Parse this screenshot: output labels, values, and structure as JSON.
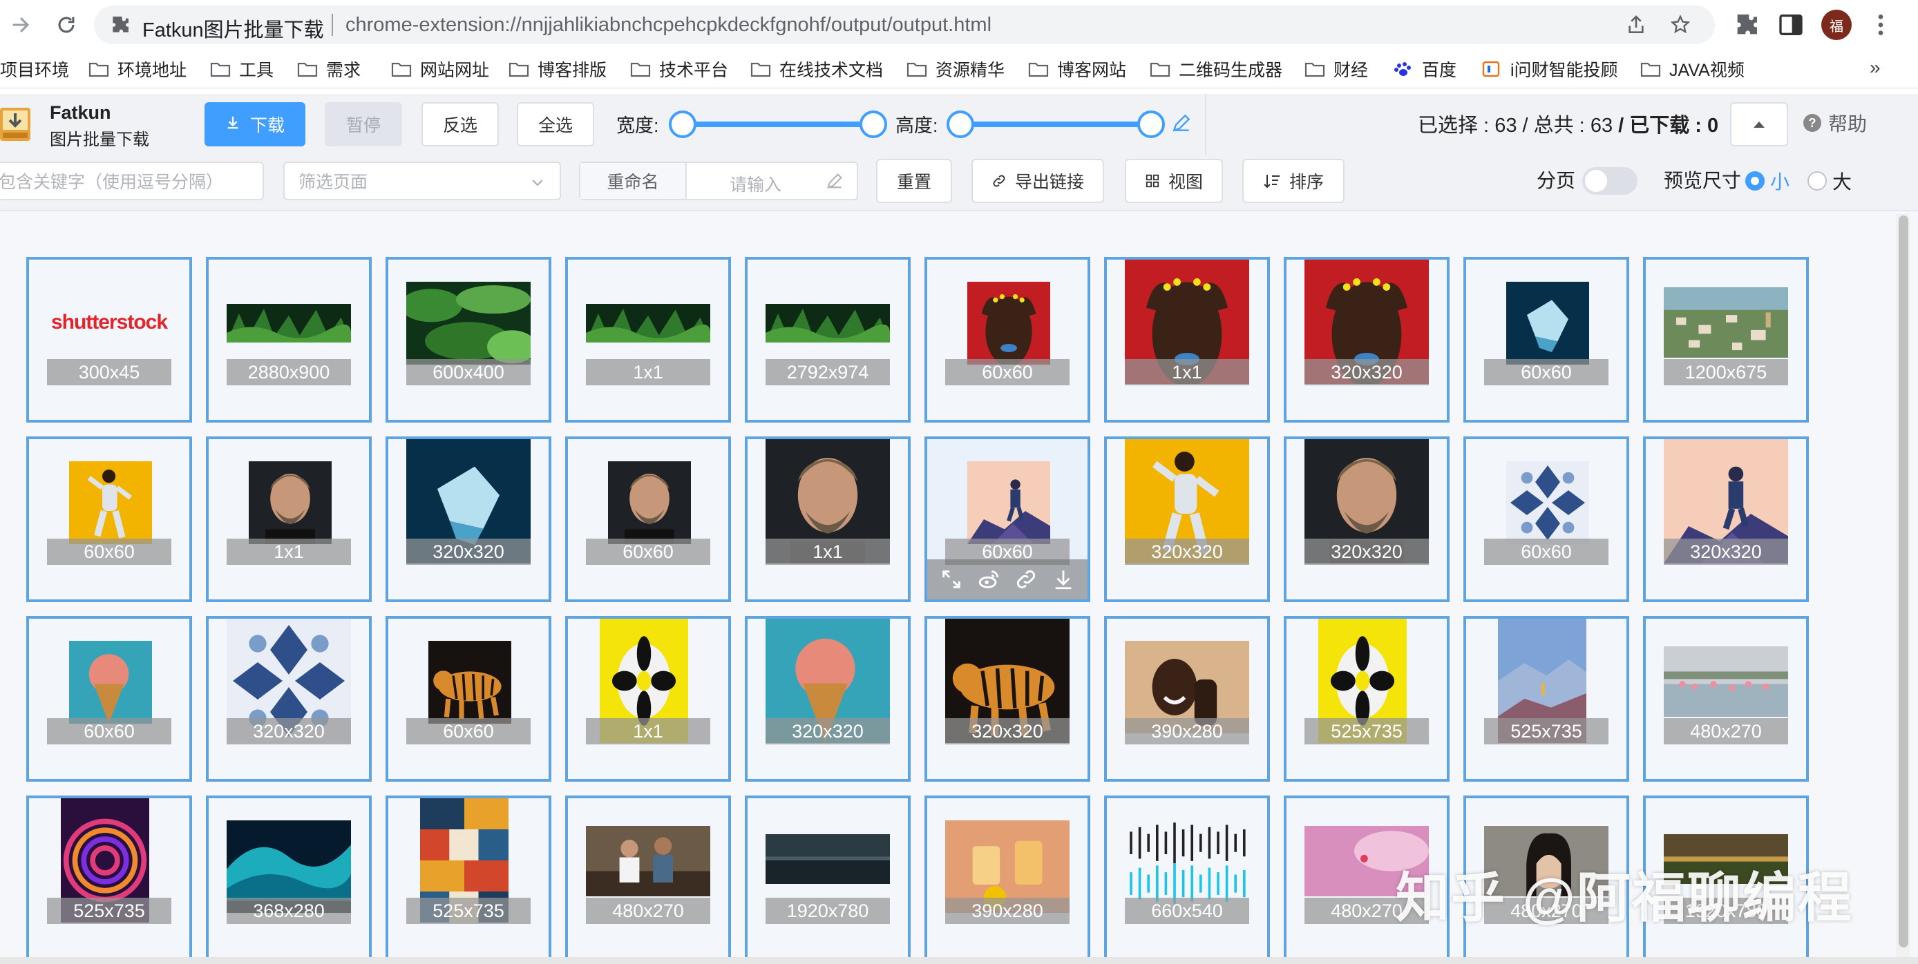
{
  "browser": {
    "tab_title": "Fatkun图片批量下载",
    "url": "chrome-extension://nnjjahlikiabnchcpehcpkdeckfgnohf/output/output.html",
    "avatar_text": "福"
  },
  "bookmarks": {
    "items": [
      {
        "label": "项目环境"
      },
      {
        "label": "环境地址"
      },
      {
        "label": "工具"
      },
      {
        "label": "需求"
      },
      {
        "label": "网站网址"
      },
      {
        "label": "博客排版"
      },
      {
        "label": "技术平台"
      },
      {
        "label": "在线技术文档"
      },
      {
        "label": "资源精华"
      },
      {
        "label": "博客网站"
      },
      {
        "label": "二维码生成器"
      },
      {
        "label": "财经"
      },
      {
        "label": "百度"
      },
      {
        "label": "i问财智能投顾"
      },
      {
        "label": "JAVA视频"
      }
    ],
    "more": "»"
  },
  "header": {
    "app_name": "Fatkun",
    "app_sub": "图片批量下载",
    "download": "下载",
    "pause": "暂停",
    "invert": "反选",
    "select_all": "全选",
    "width_label": "宽度:",
    "height_label": "高度:",
    "status_selected_label": "已选择 :",
    "status_selected": "63",
    "status_total_label": "/ 总共 :",
    "status_total": "63",
    "status_downloaded_label": "/ 已下载 :",
    "status_downloaded": "0",
    "help": "帮助"
  },
  "filters": {
    "keyword_placeholder": "包含关键字（使用逗号分隔）",
    "page_placeholder": "筛选页面",
    "rename_label": "重命名",
    "rename_placeholder": "请输入",
    "reset": "重置",
    "export": "导出链接",
    "view": "视图",
    "sort": "排序",
    "paging": "分页",
    "preview_size": "预览尺寸",
    "size_small": "小",
    "size_large": "大"
  },
  "images": [
    {
      "size": "300x45"
    },
    {
      "size": "2880x900"
    },
    {
      "size": "600x400"
    },
    {
      "size": "1x1"
    },
    {
      "size": "2792x974"
    },
    {
      "size": "60x60"
    },
    {
      "size": "1x1"
    },
    {
      "size": "320x320"
    },
    {
      "size": "60x60"
    },
    {
      "size": "1200x675"
    },
    {
      "size": "60x60"
    },
    {
      "size": "1x1"
    },
    {
      "size": "320x320"
    },
    {
      "size": "60x60"
    },
    {
      "size": "1x1"
    },
    {
      "size": "60x60"
    },
    {
      "size": "320x320"
    },
    {
      "size": "320x320"
    },
    {
      "size": "60x60"
    },
    {
      "size": "320x320"
    },
    {
      "size": "60x60"
    },
    {
      "size": "320x320"
    },
    {
      "size": "60x60"
    },
    {
      "size": "1x1"
    },
    {
      "size": "320x320"
    },
    {
      "size": "320x320"
    },
    {
      "size": "390x280"
    },
    {
      "size": "525x735"
    },
    {
      "size": "525x735"
    },
    {
      "size": "480x270"
    },
    {
      "size": "525x735"
    },
    {
      "size": "368x280"
    },
    {
      "size": "525x735"
    },
    {
      "size": "480x270"
    },
    {
      "size": "1920x780"
    },
    {
      "size": "390x280"
    },
    {
      "size": "660x540"
    },
    {
      "size": "480x270"
    },
    {
      "size": "480x270"
    },
    {
      "size": "1920x780"
    }
  ],
  "shutterstock_text": "shutterstock",
  "watermark": "知乎 @阿福聊编程",
  "colors": {
    "accent": "#409eff",
    "cell_border": "#5ea4e0",
    "bg": "#f0f2f5"
  }
}
